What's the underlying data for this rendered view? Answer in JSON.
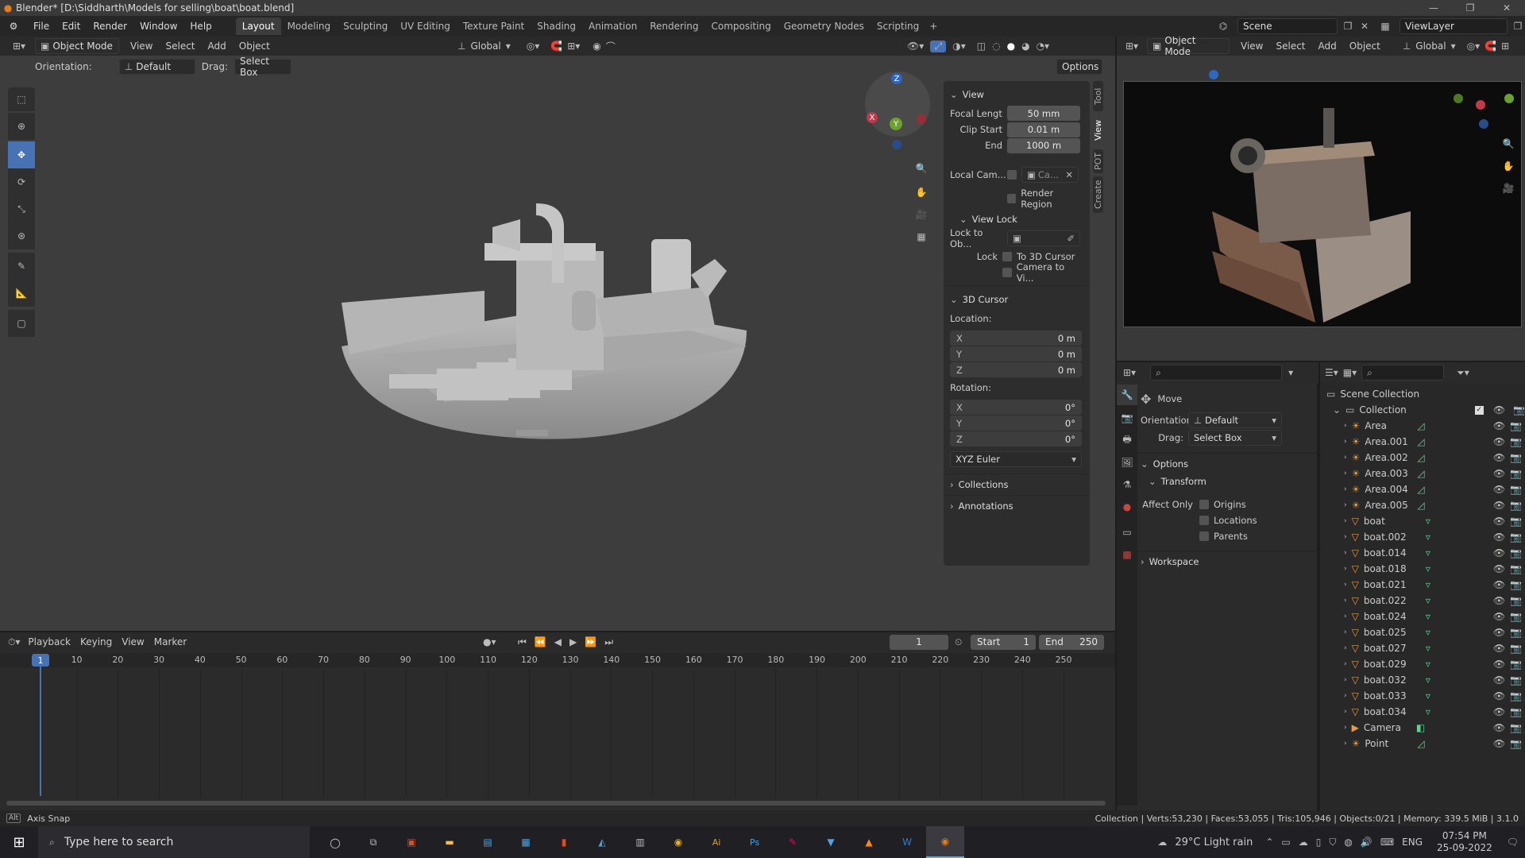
{
  "titlebar": {
    "title": "Blender* [D:\\Siddharth\\Models for selling\\boat\\boat.blend]"
  },
  "menu": [
    "File",
    "Edit",
    "Render",
    "Window",
    "Help"
  ],
  "workspaces": [
    "Layout",
    "Modeling",
    "Sculpting",
    "UV Editing",
    "Texture Paint",
    "Shading",
    "Animation",
    "Rendering",
    "Compositing",
    "Geometry Nodes",
    "Scripting"
  ],
  "active_workspace": "Layout",
  "scene": {
    "name": "Scene",
    "view_layer": "ViewLayer"
  },
  "viewport": {
    "mode": "Object Mode",
    "menus": [
      "View",
      "Select",
      "Add",
      "Object"
    ],
    "transform_orient": "Global",
    "orientation_label": "Orientation:",
    "orientation_value": "Default",
    "drag_label": "Drag:",
    "drag_value": "Select Box",
    "options": "Options",
    "tabs": [
      "Tool",
      "View",
      "POT",
      "Create"
    ]
  },
  "npanel": {
    "view_title": "View",
    "focal_label": "Focal Lengt",
    "focal_value": "50 mm",
    "clip_start_label": "Clip Start",
    "clip_start_value": "0.01 m",
    "end_label": "End",
    "end_value": "1000 m",
    "local_cam_label": "Local Cam...",
    "local_cam_value": "Ca...",
    "render_region": "Render Region",
    "view_lock_title": "View Lock",
    "lock_to_ob": "Lock to Ob...",
    "lock_label": "Lock",
    "to_3d_cursor": "To 3D Cursor",
    "camera_to_vi": "Camera to Vi...",
    "cursor_title": "3D Cursor",
    "location_label": "Location:",
    "loc": [
      {
        "axis": "X",
        "value": "0 m"
      },
      {
        "axis": "Y",
        "value": "0 m"
      },
      {
        "axis": "Z",
        "value": "0 m"
      }
    ],
    "rotation_label": "Rotation:",
    "rot": [
      {
        "axis": "X",
        "value": "0°"
      },
      {
        "axis": "Y",
        "value": "0°"
      },
      {
        "axis": "Z",
        "value": "0°"
      }
    ],
    "rot_mode": "XYZ Euler",
    "collections": "Collections",
    "annotations": "Annotations"
  },
  "camera_view": {
    "mode": "Object Mode",
    "menus": [
      "View",
      "Select",
      "Add",
      "Object"
    ],
    "transform_orient": "Global"
  },
  "properties": {
    "tool": "Move",
    "orientation_label": "Orientation",
    "orientation_value": "Default",
    "drag_label": "Drag:",
    "drag_value": "Select Box",
    "options": "Options",
    "transform": "Transform",
    "affect_only": "Affect Only",
    "affect": [
      "Origins",
      "Locations",
      "Parents"
    ],
    "workspace": "Workspace"
  },
  "outliner": {
    "scene_collection": "Scene Collection",
    "collection": "Collection",
    "items": [
      {
        "name": "Area",
        "type": "light"
      },
      {
        "name": "Area.001",
        "type": "light"
      },
      {
        "name": "Area.002",
        "type": "light"
      },
      {
        "name": "Area.003",
        "type": "light"
      },
      {
        "name": "Area.004",
        "type": "light"
      },
      {
        "name": "Area.005",
        "type": "light"
      },
      {
        "name": "boat",
        "type": "mesh"
      },
      {
        "name": "boat.002",
        "type": "mesh"
      },
      {
        "name": "boat.014",
        "type": "mesh"
      },
      {
        "name": "boat.018",
        "type": "mesh"
      },
      {
        "name": "boat.021",
        "type": "mesh"
      },
      {
        "name": "boat.022",
        "type": "mesh"
      },
      {
        "name": "boat.024",
        "type": "mesh"
      },
      {
        "name": "boat.025",
        "type": "mesh"
      },
      {
        "name": "boat.027",
        "type": "mesh"
      },
      {
        "name": "boat.029",
        "type": "mesh"
      },
      {
        "name": "boat.032",
        "type": "mesh"
      },
      {
        "name": "boat.033",
        "type": "mesh"
      },
      {
        "name": "boat.034",
        "type": "mesh"
      },
      {
        "name": "Camera",
        "type": "camera"
      },
      {
        "name": "Point",
        "type": "light"
      }
    ]
  },
  "timeline": {
    "menus": [
      "Playback",
      "Keying",
      "View",
      "Marker"
    ],
    "current_frame": "1",
    "start_label": "Start",
    "start": "1",
    "end_label": "End",
    "end": "250",
    "ticks": [
      "1",
      "10",
      "20",
      "30",
      "40",
      "50",
      "60",
      "70",
      "80",
      "90",
      "100",
      "110",
      "120",
      "130",
      "140",
      "150",
      "160",
      "170",
      "180",
      "190",
      "200",
      "210",
      "220",
      "230",
      "240",
      "250"
    ]
  },
  "statusbar": {
    "left": "Axis Snap",
    "right": "Collection | Verts:53,230 | Faces:53,055 | Tris:105,946 | Objects:0/21 | Memory: 339.5 MiB | 3.1.0"
  },
  "taskbar": {
    "search_placeholder": "Type here to search",
    "weather": "29°C  Light rain",
    "lang": "ENG",
    "time": "07:54 PM",
    "date": "25-09-2022"
  },
  "colors": {
    "accent": "#4772b3",
    "timeline_cursor": "#4772b3",
    "mesh_green": "#5fd38f",
    "light_green": "#5fd38f",
    "object_orange": "#e59b44"
  }
}
